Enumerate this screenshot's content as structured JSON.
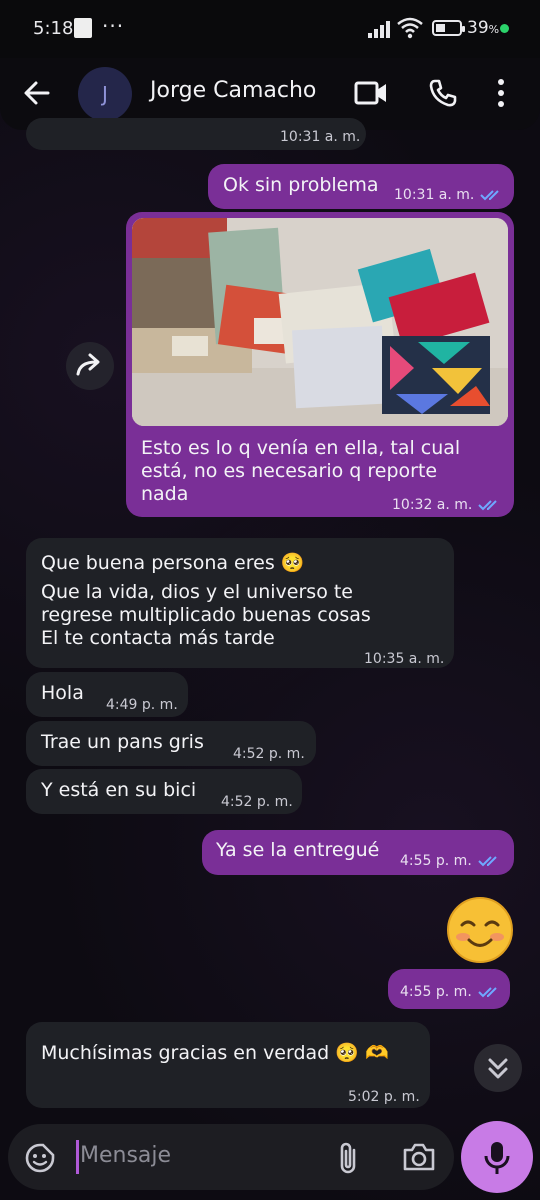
{
  "status_bar": {
    "time": "5:18",
    "dots": "···",
    "battery": "39",
    "battery_unit": "%",
    "battery_level": 0.39
  },
  "header": {
    "avatar_initial": "J",
    "contact_name": "Jorge Camacho"
  },
  "messages": [
    {
      "dir": "out",
      "time_partial": "10:31 a. m."
    },
    {
      "dir": "out",
      "text": "Ok sin problema",
      "time": "10:31 a. m."
    },
    {
      "dir": "out",
      "text": "Esto es lo q venía en ella, tal cual está, no es necesario q reporte nada",
      "line1": "Esto es lo q venía en ella, tal cual",
      "line2": "está, no es necesario q reporte",
      "line3": "nada",
      "time": "10:32 a. m.",
      "has_image": true
    },
    {
      "dir": "in",
      "line1": "Que buena persona eres",
      "line2": "Que la vida, dios y el universo te",
      "line3": "regrese multiplicado buenas cosas",
      "line4": "El te contacta más tarde",
      "time": "10:35 a. m."
    },
    {
      "dir": "in",
      "text": "Hola",
      "time": "4:49 p. m."
    },
    {
      "dir": "in",
      "text": "Trae un pans gris",
      "time": "4:52 p. m."
    },
    {
      "dir": "in",
      "text": "Y está en su bici",
      "time": "4:52 p. m."
    },
    {
      "dir": "out",
      "text": "Ya se la entregué",
      "time": "4:55 p. m."
    },
    {
      "dir": "out",
      "text": "☺️",
      "time": "4:55 p. m."
    },
    {
      "dir": "in",
      "text": "Muchísimas gracias en verdad",
      "time": "5:02 p. m."
    }
  ],
  "input": {
    "placeholder": "Mensaje"
  },
  "colors": {
    "outgoing_bubble": "#7a2f97",
    "incoming_bubble": "#1f2126",
    "accent": "#c87be6",
    "read_ticks": "#6fa8ff"
  }
}
